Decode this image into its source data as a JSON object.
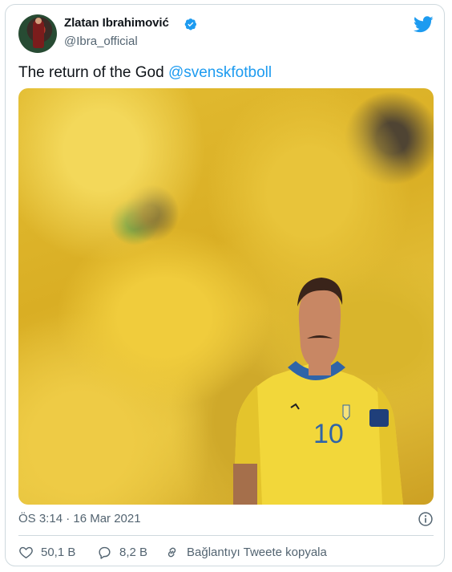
{
  "author": {
    "name": "Zlatan Ibrahimović",
    "handle": "@Ibra_official"
  },
  "tweet": {
    "text": "The return of the God ",
    "mention": "@svenskfotboll"
  },
  "photo": {
    "jersey_number": "10"
  },
  "meta": {
    "timestamp": "ÖS 3:14 · 16 Mar 2021"
  },
  "actions": {
    "likes": "50,1 B",
    "replies": "8,2 B",
    "copy_link": "Bağlantıyı Tweete kopyala"
  },
  "icons": {
    "verified": "verified-badge-icon",
    "logo": "twitter-bird-icon",
    "info": "info-icon",
    "like": "heart-icon",
    "reply": "speech-bubble-icon",
    "link": "link-icon"
  },
  "colors": {
    "accent": "#1d9bf0",
    "text": "#0f1419",
    "secondary": "#536471",
    "border": "#cfd9de"
  }
}
